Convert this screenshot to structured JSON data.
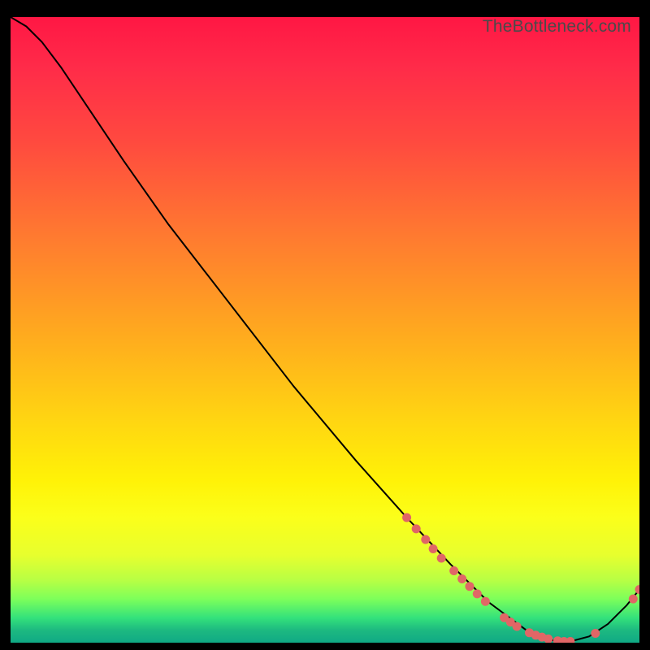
{
  "credit": "TheBottleneck.com",
  "colors": {
    "marker": "#e06666",
    "curve": "#000000"
  },
  "chart_data": {
    "type": "line",
    "title": "",
    "xlabel": "",
    "ylabel": "",
    "xlim": [
      0,
      100
    ],
    "ylim": [
      0,
      100
    ],
    "grid": false,
    "legend": false,
    "note": "Axes are unlabeled in the source image. x/y values below are estimated pixel-fraction positions scaled to 0–100. Curve descends from top-left to a minimum near x≈88 (y≈0) then rises to the right edge.",
    "curve": [
      {
        "x": 0.0,
        "y": 100.0
      },
      {
        "x": 2.5,
        "y": 98.5
      },
      {
        "x": 5.0,
        "y": 96.0
      },
      {
        "x": 8.0,
        "y": 92.0
      },
      {
        "x": 12.0,
        "y": 86.0
      },
      {
        "x": 18.0,
        "y": 77.0
      },
      {
        "x": 25.0,
        "y": 67.0
      },
      {
        "x": 35.0,
        "y": 54.0
      },
      {
        "x": 45.0,
        "y": 41.0
      },
      {
        "x": 55.0,
        "y": 29.0
      },
      {
        "x": 63.0,
        "y": 20.0
      },
      {
        "x": 70.0,
        "y": 12.5
      },
      {
        "x": 76.0,
        "y": 6.5
      },
      {
        "x": 82.0,
        "y": 2.0
      },
      {
        "x": 86.0,
        "y": 0.4
      },
      {
        "x": 89.0,
        "y": 0.2
      },
      {
        "x": 92.0,
        "y": 1.0
      },
      {
        "x": 95.0,
        "y": 3.0
      },
      {
        "x": 98.0,
        "y": 6.0
      },
      {
        "x": 100.0,
        "y": 8.5
      }
    ],
    "markers": [
      {
        "x": 63.0,
        "y": 20.0
      },
      {
        "x": 64.5,
        "y": 18.2
      },
      {
        "x": 66.0,
        "y": 16.5
      },
      {
        "x": 67.2,
        "y": 15.0
      },
      {
        "x": 68.5,
        "y": 13.5
      },
      {
        "x": 70.5,
        "y": 11.5
      },
      {
        "x": 71.8,
        "y": 10.2
      },
      {
        "x": 73.0,
        "y": 9.0
      },
      {
        "x": 74.2,
        "y": 7.8
      },
      {
        "x": 75.5,
        "y": 6.6
      },
      {
        "x": 78.5,
        "y": 4.0
      },
      {
        "x": 79.5,
        "y": 3.3
      },
      {
        "x": 80.5,
        "y": 2.6
      },
      {
        "x": 82.5,
        "y": 1.6
      },
      {
        "x": 83.5,
        "y": 1.2
      },
      {
        "x": 84.5,
        "y": 0.9
      },
      {
        "x": 85.5,
        "y": 0.6
      },
      {
        "x": 87.0,
        "y": 0.3
      },
      {
        "x": 88.0,
        "y": 0.2
      },
      {
        "x": 89.0,
        "y": 0.2
      },
      {
        "x": 93.0,
        "y": 1.5
      },
      {
        "x": 99.0,
        "y": 7.0
      },
      {
        "x": 100.0,
        "y": 8.5
      }
    ]
  }
}
